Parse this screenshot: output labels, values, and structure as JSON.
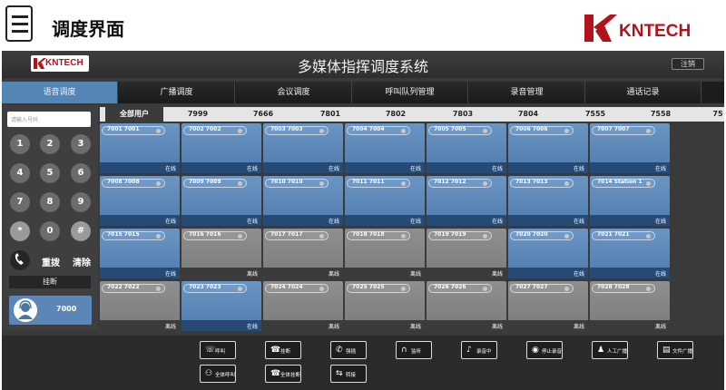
{
  "slide": {
    "title": "调度界面",
    "brand": "KNTECH"
  },
  "app": {
    "logo_text": "KNTECH",
    "title": "多媒体指挥调度系统",
    "logout": "注销"
  },
  "nav": [
    "语音调度",
    "广播调度",
    "会议调度",
    "呼叫队列管理",
    "录音管理",
    "通话记录"
  ],
  "dialpad": {
    "input_placeholder": "请输入号码",
    "keys": [
      "1",
      "2",
      "3",
      "4",
      "5",
      "6",
      "7",
      "8",
      "9",
      "*",
      "0",
      "#"
    ],
    "redial": "重拨",
    "clear": "清除",
    "hangup": "挂断",
    "my_number": "7000"
  },
  "groups": [
    "全部用户",
    "7999",
    "7666",
    "7801",
    "7802",
    "7803",
    "7804",
    "7555",
    "7558",
    "75"
  ],
  "tiles": [
    {
      "name": "7001 7001",
      "status": "在线"
    },
    {
      "name": "7002 7002",
      "status": "在线"
    },
    {
      "name": "7003 7003",
      "status": "在线"
    },
    {
      "name": "7004 7004",
      "status": "在线"
    },
    {
      "name": "7005 7005",
      "status": "在线"
    },
    {
      "name": "7006 7006",
      "status": "在线"
    },
    {
      "name": "7007 7007",
      "status": "在线"
    },
    {
      "name": "7008 7008",
      "status": "在线"
    },
    {
      "name": "7009 7009",
      "status": "在线"
    },
    {
      "name": "7010 7010",
      "status": "在线"
    },
    {
      "name": "7011 7011",
      "status": "在线"
    },
    {
      "name": "7012 7012",
      "status": "在线"
    },
    {
      "name": "7013 7013",
      "status": "在线"
    },
    {
      "name": "7014 Station 1",
      "status": "在线"
    },
    {
      "name": "7015 7015",
      "status": "在线"
    },
    {
      "name": "7016 7016",
      "status": "离线"
    },
    {
      "name": "7017 7017",
      "status": "离线"
    },
    {
      "name": "7018 7018",
      "status": "离线"
    },
    {
      "name": "7019 7019",
      "status": "离线"
    },
    {
      "name": "7020 7020",
      "status": "在线"
    },
    {
      "name": "7021 7021",
      "status": "在线"
    },
    {
      "name": "7022 7022",
      "status": "离线"
    },
    {
      "name": "7023 7023",
      "status": "在线"
    },
    {
      "name": "7024 7024",
      "status": "离线"
    },
    {
      "name": "7025 7025",
      "status": "离线"
    },
    {
      "name": "7026 7026",
      "status": "离线"
    },
    {
      "name": "7027 7027",
      "status": "离线"
    },
    {
      "name": "7028 7028",
      "status": "离线"
    }
  ],
  "toolbar": [
    {
      "label": "呼叫",
      "icon": "phone-icon"
    },
    {
      "label": "挂断",
      "icon": "hangup-icon"
    },
    {
      "label": "强插",
      "icon": "barge-icon"
    },
    {
      "label": "监听",
      "icon": "headphones-icon"
    },
    {
      "label": "录音中",
      "icon": "mic-icon"
    },
    {
      "label": "停止录音",
      "icon": "stop-icon"
    },
    {
      "label": "人工广播",
      "icon": "person-icon"
    },
    {
      "label": "文件广播",
      "icon": "file-icon"
    },
    {
      "label": "全体呼叫",
      "icon": "group-icon"
    },
    {
      "label": "全体挂断",
      "icon": "hangup-all-icon"
    },
    {
      "label": "转接",
      "icon": "transfer-icon"
    }
  ],
  "colors": {
    "online": "#5b86b6",
    "offline": "#858585",
    "brand_red": "#b3121b",
    "active_tab": "#5585b5"
  }
}
